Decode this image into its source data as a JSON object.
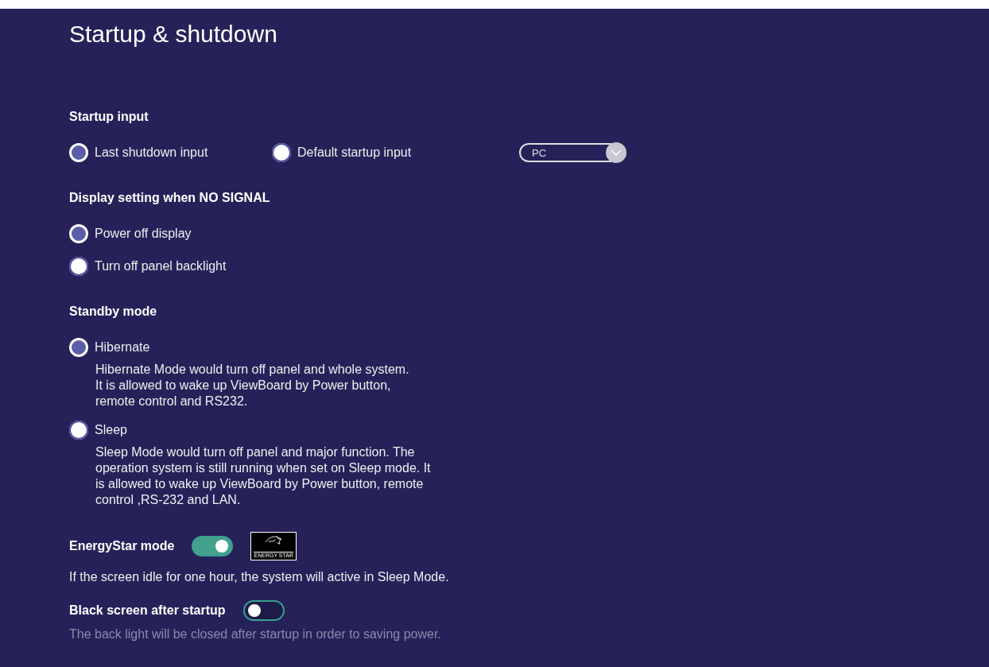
{
  "title": "Startup & shutdown",
  "startup_input": {
    "heading": "Startup input",
    "options": [
      {
        "label": "Last shutdown input",
        "selected": true
      },
      {
        "label": "Default startup input",
        "selected": false
      }
    ],
    "dropdown": {
      "value": "PC"
    }
  },
  "no_signal": {
    "heading": "Display setting when NO SIGNAL",
    "options": [
      {
        "label": "Power off display",
        "selected": true
      },
      {
        "label": "Turn off panel backlight",
        "selected": false
      }
    ]
  },
  "standby": {
    "heading": "Standby mode",
    "options": [
      {
        "label": "Hibernate",
        "selected": true,
        "description": "Hibernate Mode would turn off panel and whole system.\nIt is allowed to wake up ViewBoard by Power button,\nremote control and RS232."
      },
      {
        "label": "Sleep",
        "selected": false,
        "description": "Sleep Mode would turn off panel and major function. The\noperation system is still running when set on Sleep mode. It\nis allowed to wake up ViewBoard by Power button, remote\ncontrol ,RS-232 and LAN."
      }
    ]
  },
  "toggles": [
    {
      "label": "EnergyStar mode",
      "on": true,
      "logo_text": "ENERGY STAR",
      "description": "If the screen idle for one hour, the system will active in Sleep Mode.",
      "disabled": false
    },
    {
      "label": "Black screen after startup",
      "on": false,
      "description": "The back light will be closed after startup in order to saving power.",
      "disabled": true
    }
  ]
}
